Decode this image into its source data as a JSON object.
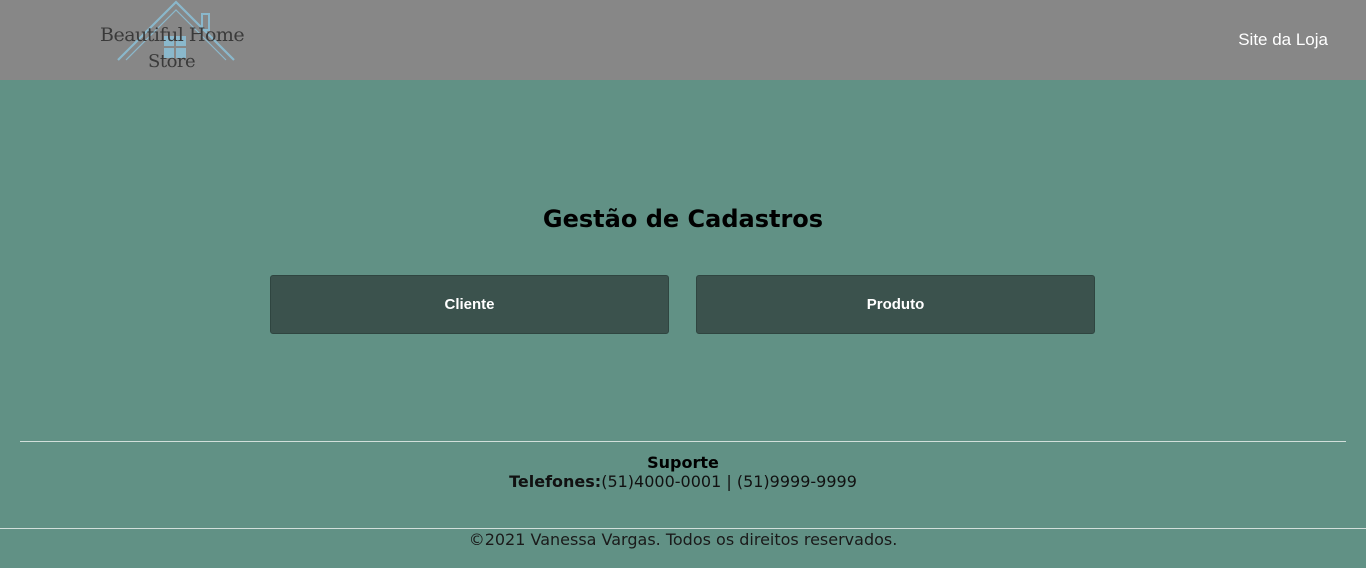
{
  "header": {
    "logo_line1": "Beautiful Home",
    "logo_line2": "Store",
    "store_link": "Site da Loja"
  },
  "main": {
    "title": "Gestão de Cadastros",
    "buttons": [
      {
        "label": "Cliente"
      },
      {
        "label": "Produto"
      }
    ]
  },
  "footer": {
    "support_title": "Suporte",
    "phones_label": "Telefones:",
    "phones_value": "(51)4000-0001 | (51)9999-9999",
    "copyright": "©2021 Vanessa Vargas. Todos os direitos reservados."
  },
  "colors": {
    "header_bg": "#878787",
    "page_bg": "#619185",
    "button_bg": "#3b524d",
    "logo_accent": "#8ab8cc"
  }
}
